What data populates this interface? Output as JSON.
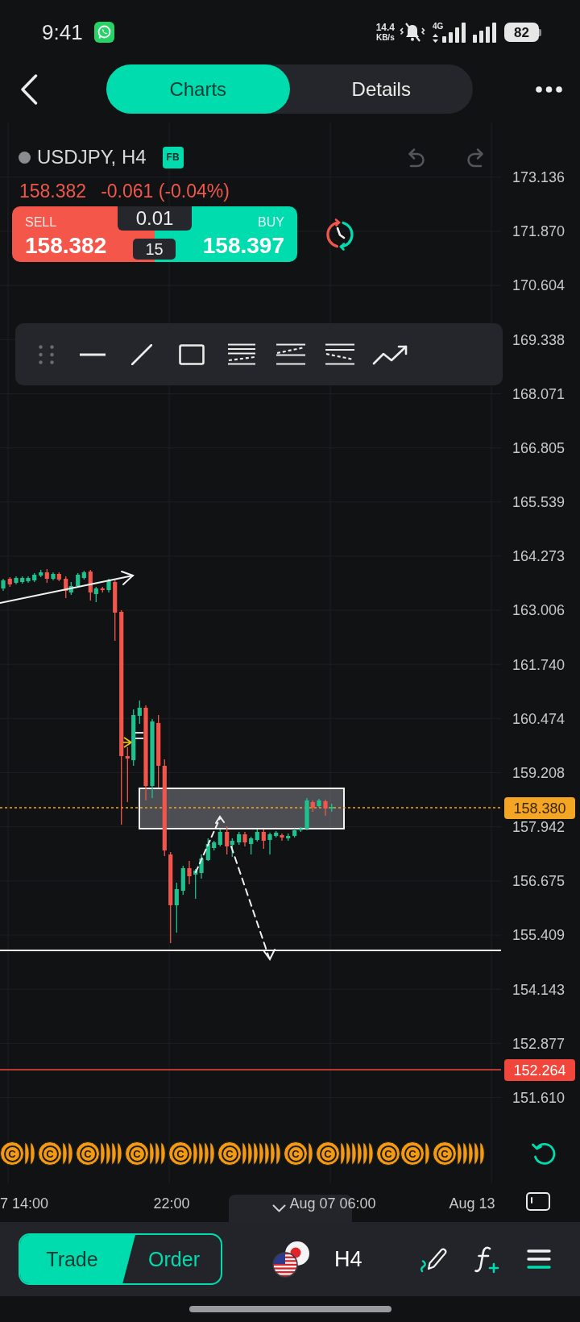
{
  "status_bar": {
    "time": "9:41",
    "speed": "14.4",
    "speed_unit": "KB/s",
    "network": "4G",
    "battery": "82"
  },
  "header": {
    "tabs": [
      {
        "label": "Charts",
        "selected": true
      },
      {
        "label": "Details",
        "selected": false
      }
    ]
  },
  "symbol": {
    "name": "USDJPY, H4",
    "badge": "FB",
    "last_price": "158.382",
    "change": "-0.061 (-0.04%)",
    "undo": {
      "disabled": true
    },
    "redo": {
      "disabled": true
    }
  },
  "quote": {
    "sell_label": "SELL",
    "sell_price": "158.382",
    "lot": "0.01",
    "spread": "15",
    "buy_label": "BUY",
    "buy_price": "158.397"
  },
  "chart": {
    "price_axis": [
      "173.136",
      "171.870",
      "170.604",
      "169.338",
      "168.071",
      "166.805",
      "165.539",
      "164.273",
      "163.006",
      "161.740",
      "160.474",
      "159.208",
      "157.942",
      "156.675",
      "155.409",
      "154.143",
      "152.877",
      "151.610"
    ],
    "price_tags": [
      {
        "kind": "last",
        "label": "158.380",
        "color": "#f5a524"
      },
      {
        "kind": "level",
        "label": "152.264",
        "color": "#f0463c"
      }
    ],
    "events": [
      {
        "kind": "marker",
        "label": "C"
      },
      {
        "kind": "edge"
      },
      {
        "kind": "edge"
      },
      {
        "kind": "marker",
        "label": "C"
      },
      {
        "kind": "edge"
      },
      {
        "kind": "edge"
      },
      {
        "kind": "marker",
        "label": "C"
      },
      {
        "kind": "edge"
      },
      {
        "kind": "edge"
      },
      {
        "kind": "edge"
      },
      {
        "kind": "edge"
      },
      {
        "kind": "marker",
        "label": "C"
      },
      {
        "kind": "edge"
      },
      {
        "kind": "edge"
      },
      {
        "kind": "edge"
      },
      {
        "kind": "marker",
        "label": "C"
      },
      {
        "kind": "edge"
      },
      {
        "kind": "edge"
      },
      {
        "kind": "edge"
      },
      {
        "kind": "edge"
      },
      {
        "kind": "marker",
        "label": "C"
      },
      {
        "kind": "edge"
      },
      {
        "kind": "edge"
      },
      {
        "kind": "edge"
      },
      {
        "kind": "edge"
      },
      {
        "kind": "edge"
      },
      {
        "kind": "edge"
      },
      {
        "kind": "edge"
      },
      {
        "kind": "marker",
        "label": "C"
      },
      {
        "kind": "edge"
      },
      {
        "kind": "marker",
        "label": "C"
      },
      {
        "kind": "edge"
      },
      {
        "kind": "edge"
      },
      {
        "kind": "edge"
      },
      {
        "kind": "edge"
      },
      {
        "kind": "edge"
      },
      {
        "kind": "edge"
      },
      {
        "kind": "marker",
        "label": "C"
      },
      {
        "kind": "marker",
        "label": "C"
      },
      {
        "kind": "edge"
      },
      {
        "kind": "marker",
        "label": "C"
      },
      {
        "kind": "edge"
      },
      {
        "kind": "edge"
      },
      {
        "kind": "edge"
      },
      {
        "kind": "edge"
      },
      {
        "kind": "edge"
      }
    ],
    "time_axis": [
      "7 14:00",
      "22:00",
      "Aug 07 06:00",
      "Aug 13"
    ]
  },
  "bottom_bar": {
    "modes": [
      {
        "label": "Trade",
        "selected": true
      },
      {
        "label": "Order",
        "selected": false
      }
    ],
    "timeframe": "H4"
  }
}
